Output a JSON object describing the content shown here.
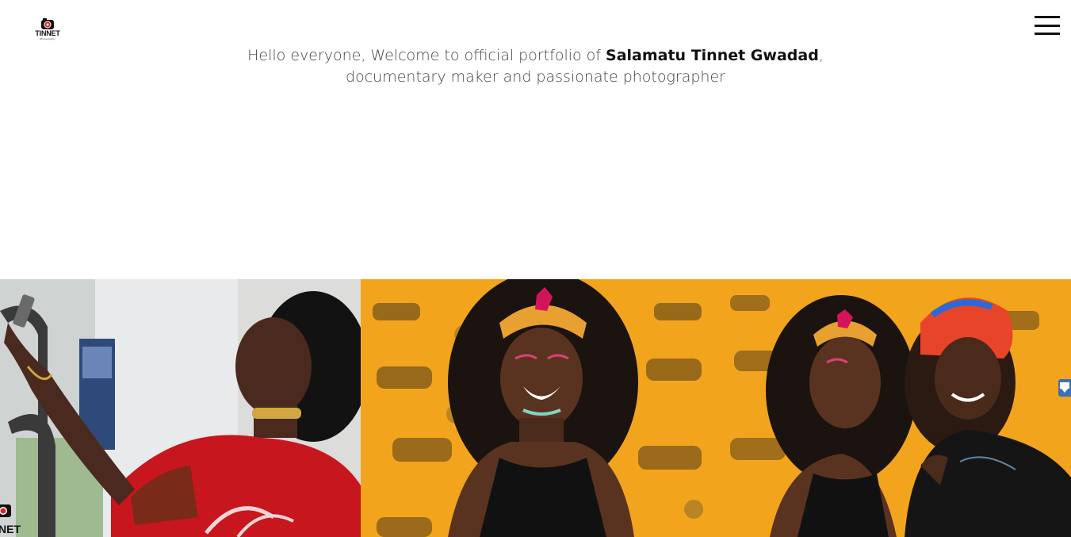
{
  "header": {
    "logo": {
      "text": "TINNET",
      "subtext": "Photography"
    },
    "menu_icon": "hamburger-menu-icon"
  },
  "intro": {
    "greeting": "Hello everyone, Welcome to official portfolio of ",
    "name": "Salamatu Tinnet Gwadad",
    "comma": ",",
    "tagline": "documentary maker and passionate photographer"
  },
  "gallery": {
    "photos": [
      {
        "subject": "woman-taking-selfie-red-dress"
      },
      {
        "subject": "smiling-woman-headband-yellow-backdrop"
      },
      {
        "subject": "two-women-yellow-zebra-backdrop"
      }
    ]
  },
  "side_tab": {
    "icon": "download-arrow-icon"
  },
  "watermark": {
    "text": "NET"
  },
  "colors": {
    "background": "#ffffff",
    "text": "#444444",
    "accent_red": "#d8282a",
    "backdrop_yellow": "#f2a51c",
    "tab_blue": "#3d6fb6"
  }
}
